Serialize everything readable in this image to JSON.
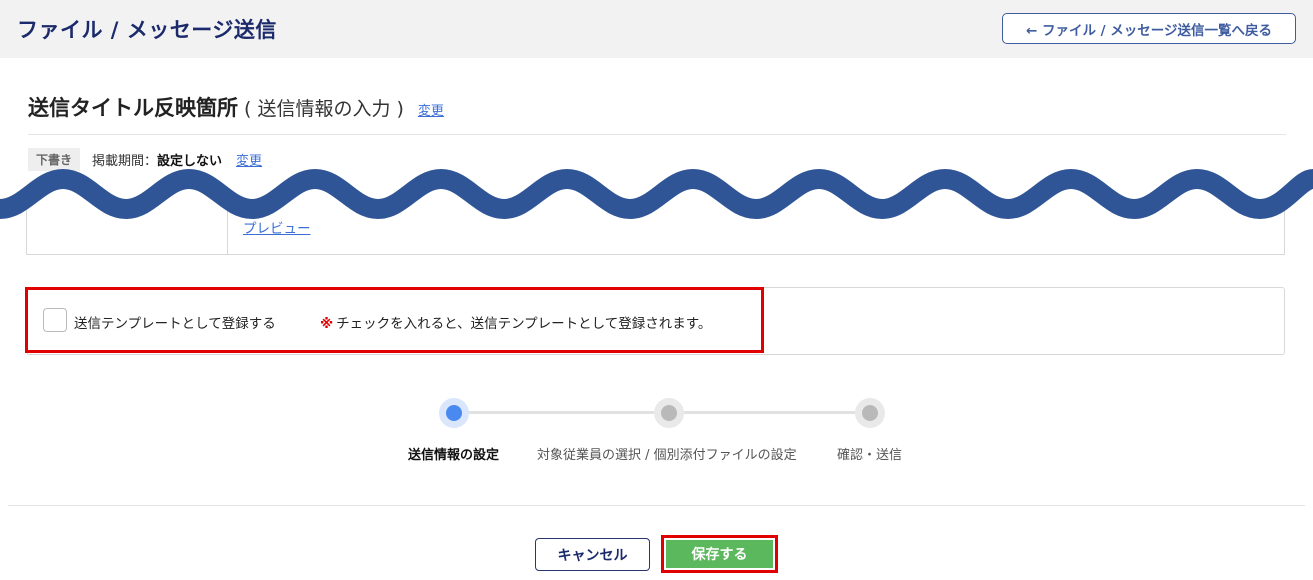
{
  "header": {
    "title": "ファイル / メッセージ送信",
    "back_button": "← ファイル / メッセージ送信一覧へ戻る"
  },
  "section": {
    "title": "送信タイトル反映箇所",
    "subtitle": "( 送信情報の入力 )",
    "change_link": "変更"
  },
  "status": {
    "badge": "下書き",
    "period_label": "掲載期間：",
    "period_value": "設定しない",
    "change_link": "変更"
  },
  "preview": {
    "link": "プレビュー"
  },
  "template": {
    "checkbox_label": "送信テンプレートとして登録する",
    "note_mark": "※",
    "note_text": "チェックを入れると、送信テンプレートとして登録されます。",
    "checked": false
  },
  "stepper": {
    "steps": [
      {
        "label": "送信情報の設定",
        "active": true
      },
      {
        "label": "対象従業員の選択 / 個別添付ファイルの設定",
        "active": false
      },
      {
        "label": "確認・送信",
        "active": false
      }
    ]
  },
  "footer": {
    "cancel_label": "キャンセル",
    "save_label": "保存する"
  },
  "colors": {
    "accent": "#1b2a6b",
    "link": "#3b6fd6",
    "save_green": "#5cb85c",
    "highlight_red": "#e10000",
    "wave_blue": "#2f5596"
  }
}
